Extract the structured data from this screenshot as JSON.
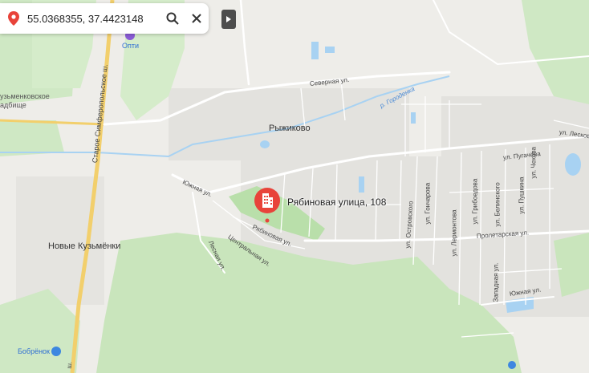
{
  "search": {
    "coordinates": "55.0368355, 37.4423148",
    "pin_icon": "location-pin-icon",
    "search_icon": "magnifier-icon",
    "clear_icon": "close-icon"
  },
  "map": {
    "marker": {
      "label": "Рябиновая улица, 108",
      "icon": "building-icon",
      "color": "#e8433a"
    },
    "places": [
      {
        "id": "ryzhikovo",
        "label": "Рыжиково"
      },
      {
        "id": "novye-kuzmenki",
        "label": "Новые Кузьмёнки"
      },
      {
        "id": "cemetery-1",
        "label": "узьменковское"
      },
      {
        "id": "cemetery-2",
        "label": "адбище"
      }
    ],
    "pois": [
      {
        "id": "opti",
        "label": "Опти"
      },
      {
        "id": "bobrenok",
        "label": "Бобрёнок"
      }
    ],
    "rivers": [
      {
        "id": "gorodenka",
        "label": "р. Городенка"
      }
    ],
    "streets": [
      {
        "id": "simferopol",
        "label": "Старое Симферопольское ш."
      },
      {
        "id": "simferopol-2",
        "label": "ш."
      },
      {
        "id": "severnaya",
        "label": "Северная ул."
      },
      {
        "id": "yuzhnaya",
        "label": "Южная ул."
      },
      {
        "id": "ryabinovaya",
        "label": "Рябиновая ул."
      },
      {
        "id": "tsentralnaya",
        "label": "Центральная ул."
      },
      {
        "id": "lesnaya",
        "label": "Лесная ул."
      },
      {
        "id": "ostrovskogo",
        "label": "ул. Островского"
      },
      {
        "id": "goncharova",
        "label": "ул. Гончарова"
      },
      {
        "id": "lermontova",
        "label": "ул. Лермонтова"
      },
      {
        "id": "griboedova",
        "label": "ул. Грибоедова"
      },
      {
        "id": "belinskogo",
        "label": "ул. Белинского"
      },
      {
        "id": "pushkina",
        "label": "ул. Пушкина"
      },
      {
        "id": "chekhova",
        "label": "ул. Чехова"
      },
      {
        "id": "pugacheva",
        "label": "ул. Пугачёва"
      },
      {
        "id": "leskova",
        "label": "ул. Лескова"
      },
      {
        "id": "proletarskaya",
        "label": "Пролетарская ул."
      },
      {
        "id": "zapadnaya",
        "label": "Западная ул."
      },
      {
        "id": "yuzhnaya-2",
        "label": "Южная ул."
      }
    ],
    "colors": {
      "background": "#e9e7e2",
      "settlement": "#e6e4df",
      "forest": "#cfe8c4",
      "park": "#b9dfaa",
      "water": "#a8d2f2",
      "road": "#ffffff",
      "highway": "#f2cf6c"
    }
  }
}
